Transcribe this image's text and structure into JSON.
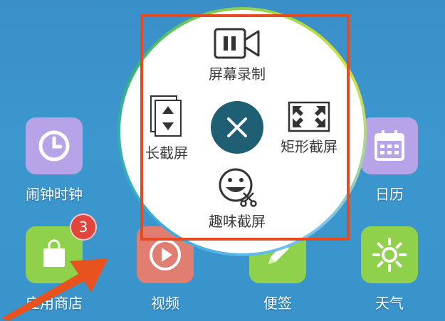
{
  "apps": {
    "clock": {
      "label": "闹钟时钟",
      "icon": "clock-icon",
      "color": "#b7a3e8"
    },
    "store": {
      "label": "应用商店",
      "icon": "shopping-bag-icon",
      "color": "#8fd14a",
      "badge": "3"
    },
    "video": {
      "label": "视频",
      "icon": "play-icon",
      "color": "#e07e72"
    },
    "notes": {
      "label": "便签",
      "icon": "pencil-icon",
      "color": "#8fd14a"
    },
    "weather": {
      "label": "天气",
      "icon": "sun-icon",
      "color": "#8fd14a"
    },
    "calendar": {
      "label": "日历",
      "icon": "calendar-icon",
      "color": "#b7a3e8"
    }
  },
  "menu": {
    "screen_record": {
      "label": "屏幕录制",
      "icon": "video-camera-icon"
    },
    "long_screenshot": {
      "label": "长截屏",
      "icon": "scroll-pages-icon"
    },
    "rect_screenshot": {
      "label": "矩形截屏",
      "icon": "expand-corners-icon"
    },
    "fun_screenshot": {
      "label": "趣味截屏",
      "icon": "smiley-scissors-icon"
    },
    "close": {
      "icon": "close-icon"
    }
  },
  "colors": {
    "highlight": "#e64a1f",
    "close_button": "#1e5f73",
    "arrow": "#e8521e"
  }
}
